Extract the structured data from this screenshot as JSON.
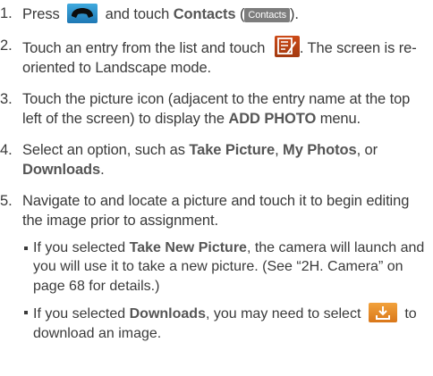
{
  "steps": [
    {
      "num": "1.",
      "t1": "Press",
      "t2": "and touch",
      "contacts_bold": "Contacts",
      "paren_open": "(",
      "contacts_chip": "Contacts",
      "paren_close": ")."
    },
    {
      "num": "2.",
      "t1": "Touch an entry from the list and touch",
      "t2": ". The screen is re-oriented to Landscape mode."
    },
    {
      "num": "3.",
      "t1": "Touch the picture icon (adjacent to the entry name at the top left of the screen) to display the",
      "bold": "ADD PHOTO",
      "t2": "menu."
    },
    {
      "num": "4.",
      "t1": "Select an option, such as",
      "b1": "Take Picture",
      "t2": ",",
      "b2": "My Photos",
      "t3": ", or",
      "b3": "Downloads",
      "t4": "."
    },
    {
      "num": "5.",
      "t1": "Navigate to and locate a picture and touch it to begin editing the image prior to assignment."
    }
  ],
  "bullets": [
    {
      "t1": "If you selected",
      "bold": "Take New Picture",
      "t2": ", the camera will launch and you will use it to take a new picture. (See “2H. Camera” on page 68 for details.)"
    },
    {
      "t1": "If you selected",
      "bold": "Downloads",
      "t2": ", you may need to select",
      "t3": "to download an image."
    }
  ],
  "icons": {
    "phone": "phone-handset-icon",
    "edit": "edit-contact-icon",
    "download": "download-icon"
  },
  "colors": {
    "phone_icon": "#2b8fd0",
    "edit_icon": "#b8441a",
    "download_icon": "#e88a24",
    "contacts_chip": "#7d7d7d"
  }
}
